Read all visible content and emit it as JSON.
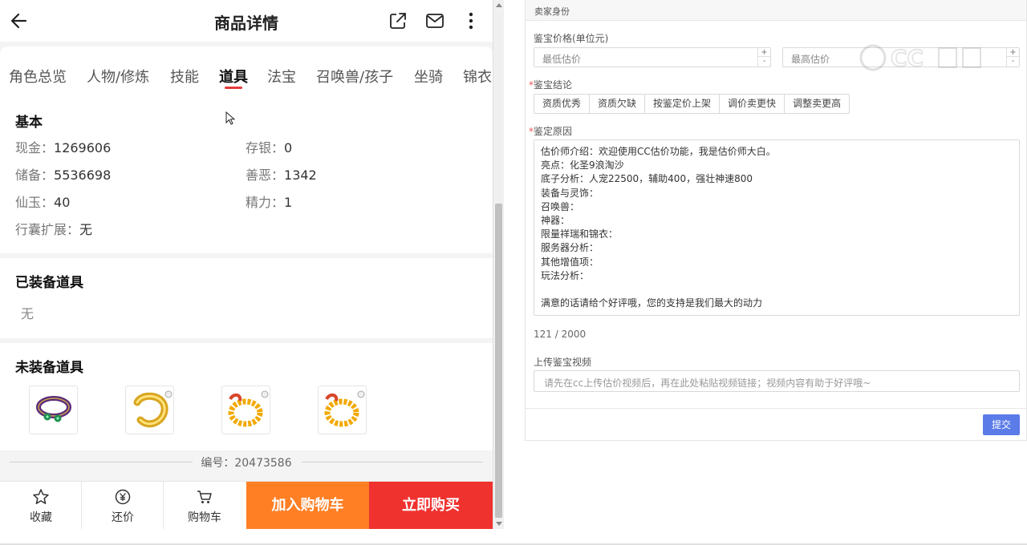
{
  "header": {
    "title": "商品详情",
    "icons": [
      "back-arrow-icon",
      "share-icon",
      "mail-icon",
      "more-vertical-icon"
    ]
  },
  "tabs": [
    "角色总览",
    "人物/修炼",
    "技能",
    "道具",
    "法宝",
    "召唤兽/孩子",
    "坐骑",
    "锦衣"
  ],
  "active_tab": "道具",
  "basic": {
    "title": "基本",
    "fields": [
      {
        "label": "现金：",
        "value": "1269606"
      },
      {
        "label": "存银：",
        "value": "0"
      },
      {
        "label": "储备：",
        "value": "5536698"
      },
      {
        "label": "善恶：",
        "value": "1342"
      },
      {
        "label": "仙玉：",
        "value": "40"
      },
      {
        "label": "精力：",
        "value": "1"
      },
      {
        "label": "行囊扩展：",
        "value": "无"
      }
    ]
  },
  "equipped": {
    "title": "已装备道具",
    "empty": "无"
  },
  "unequipped": {
    "title": "未装备道具",
    "items": [
      "jade-ring-item",
      "gold-bracelet-item",
      "gold-bead-bracelet-item",
      "gold-bead-bracelet-item"
    ]
  },
  "serial": "编号：20473586",
  "bottom_bar": {
    "favorite": "收藏",
    "bargain": "还价",
    "cart": "购物车",
    "add_to_cart": "加入购物车",
    "buy_now": "立即购买"
  },
  "form": {
    "header": "卖家身份",
    "price_label": "鉴宝价格(单位元)",
    "min_price_placeholder": "最低估价",
    "max_price_placeholder": "最高估价",
    "conclusion_label": "鉴宝结论",
    "conclusion_options": [
      "资质优秀",
      "资质欠缺",
      "按鉴定价上架",
      "调价卖更快",
      "调整卖更高"
    ],
    "reason_label": "鉴定原因",
    "reason_lines": [
      "估价师介绍：欢迎使用CC估价功能，我是估价师大白。",
      "亮点：化圣9浪淘沙",
      "底子分析：人宠22500，辅助400，强壮神速800",
      "装备与灵饰：",
      "召唤兽：",
      "神器：",
      "限量祥瑞和锦衣：",
      "服务器分析：",
      "其他增值项：",
      "玩法分析：",
      "",
      "满意的话请给个好评哦，您的支持是我们最大的动力"
    ],
    "counter": "121 / 2000",
    "video_label": "上传鉴宝视频",
    "video_placeholder": "请先在cc上传估价视频后，再在此处粘贴视频链接；视频内容有助于好评哦~",
    "submit": "提交",
    "watermark": "CC"
  },
  "colors": {
    "tab_underline": "#e63a3a",
    "add_to_cart": "#ff7f24",
    "buy_now": "#f0322f",
    "submit": "#5b7be8"
  }
}
